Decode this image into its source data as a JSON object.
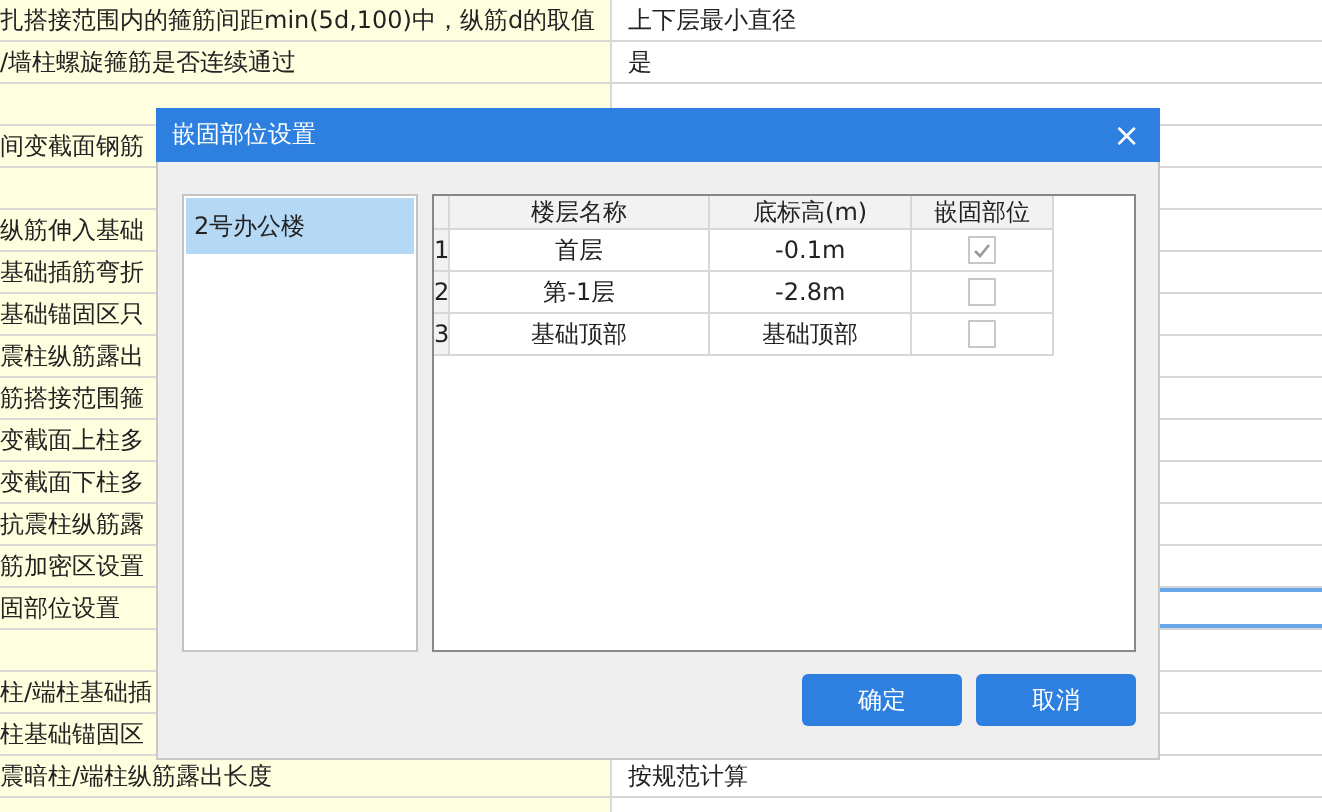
{
  "settings_table": {
    "rows": [
      {
        "name": "扎搭接范围内的箍筋间距min(5d,100)中，纵筋d的取值",
        "value": "上下层最小直径",
        "selected": false
      },
      {
        "name": "/墙柱螺旋箍筋是否连续通过",
        "value": "是",
        "selected": false
      },
      {
        "name": "",
        "value": "",
        "selected": false
      },
      {
        "name": "间变截面钢筋",
        "value": "",
        "selected": false
      },
      {
        "name": "",
        "value": "",
        "selected": false
      },
      {
        "name": "纵筋伸入基础",
        "value": "",
        "selected": false
      },
      {
        "name": "基础插筋弯折",
        "value": "",
        "selected": false
      },
      {
        "name": "基础锚固区只",
        "value": "",
        "selected": false
      },
      {
        "name": "震柱纵筋露出",
        "value": "",
        "selected": false
      },
      {
        "name": "筋搭接范围箍",
        "value": "",
        "selected": false
      },
      {
        "name": "变截面上柱多",
        "value": "",
        "selected": false
      },
      {
        "name": "变截面下柱多",
        "value": "",
        "selected": false
      },
      {
        "name": "抗震柱纵筋露",
        "value": "",
        "selected": false
      },
      {
        "name": "筋加密区设置",
        "value": "",
        "selected": false
      },
      {
        "name": "固部位设置",
        "value": "",
        "selected": true
      },
      {
        "name": "",
        "value": "",
        "selected": false
      },
      {
        "name": "柱/端柱基础插",
        "value": "",
        "selected": false
      },
      {
        "name": "柱基础锚固区",
        "value": "",
        "selected": false
      },
      {
        "name": "震暗柱/端柱纵筋露出长度",
        "value": "按规范计算",
        "selected": false
      }
    ]
  },
  "dialog": {
    "title": "嵌固部位设置",
    "close": "×",
    "buildings": [
      {
        "label": "2号办公楼",
        "selected": true
      }
    ],
    "floor_table": {
      "columns": [
        "楼层名称",
        "底标高(m)",
        "嵌固部位"
      ],
      "rows": [
        {
          "number": "1",
          "name": "首层",
          "elevation": "-0.1m",
          "checked": true
        },
        {
          "number": "2",
          "name": "第-1层",
          "elevation": "-2.8m",
          "checked": false
        },
        {
          "number": "3",
          "name": "基础顶部",
          "elevation": "基础顶部",
          "checked": false
        }
      ]
    },
    "buttons": [
      "确定",
      "取消"
    ]
  }
}
